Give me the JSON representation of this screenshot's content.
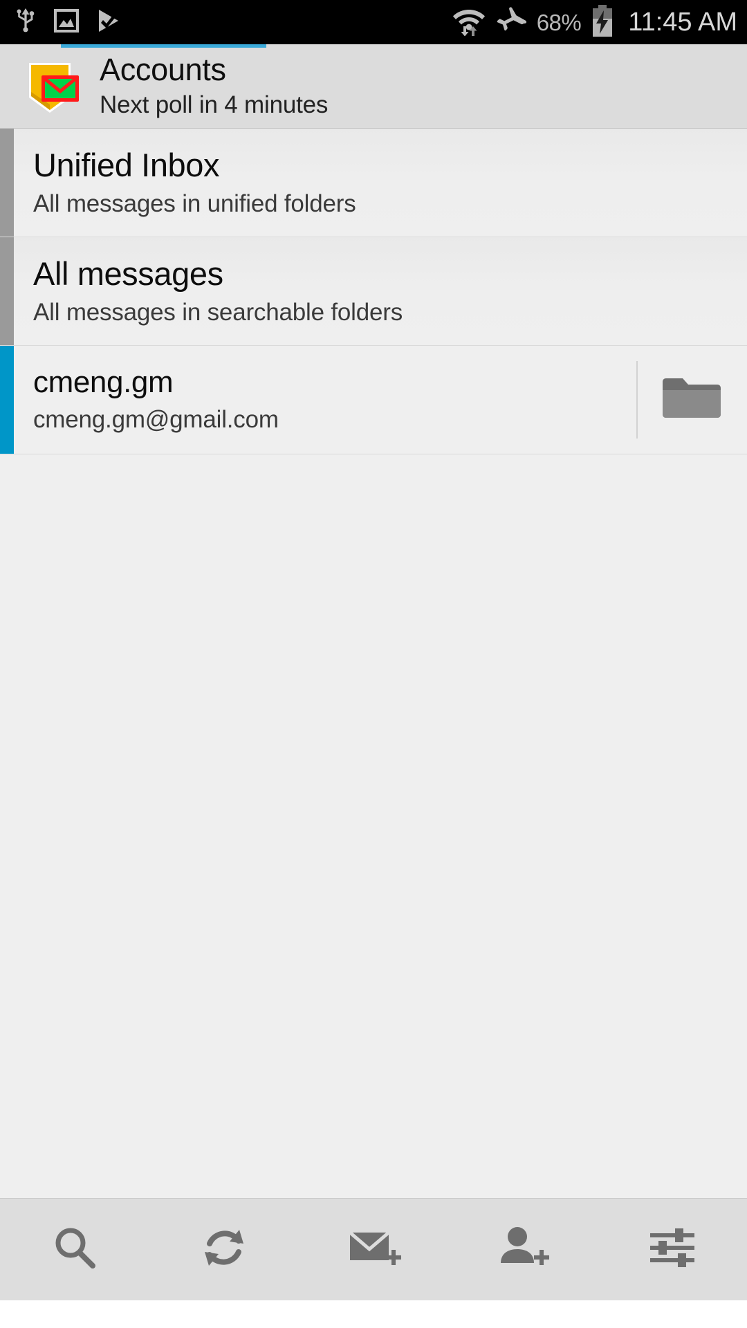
{
  "status_bar": {
    "icons_left": [
      "usb-icon",
      "screenshot-image-icon",
      "checkmark-flag-icon"
    ],
    "wifi_icon": "wifi-transfer-icon",
    "airplane_icon": "airplane-mode-icon",
    "battery_percent": "68%",
    "battery_icon": "battery-charging-icon",
    "time": "11:45 AM"
  },
  "header": {
    "logo_icon": "k9-mail-logo-icon",
    "title": "Accounts",
    "subtitle": "Next poll in 4 minutes",
    "accent_color": "#3aa9d8"
  },
  "accounts": [
    {
      "title": "Unified Inbox",
      "subtitle": "All messages in unified folders",
      "accent_color": "#9a9a9a",
      "has_folder_button": false
    },
    {
      "title": "All messages",
      "subtitle": "All messages in searchable folders",
      "accent_color": "#9a9a9a",
      "has_folder_button": false
    },
    {
      "title": "cmeng.gm",
      "subtitle": "cmeng.gm@gmail.com",
      "accent_color": "#0096c8",
      "has_folder_button": true,
      "folder_icon": "folder-icon"
    }
  ],
  "toolbar": {
    "items": [
      {
        "icon": "search-icon",
        "label": "Search"
      },
      {
        "icon": "refresh-icon",
        "label": "Refresh"
      },
      {
        "icon": "compose-mail-icon",
        "label": "Compose"
      },
      {
        "icon": "add-account-icon",
        "label": "Add account"
      },
      {
        "icon": "settings-sliders-icon",
        "label": "Settings"
      }
    ]
  }
}
